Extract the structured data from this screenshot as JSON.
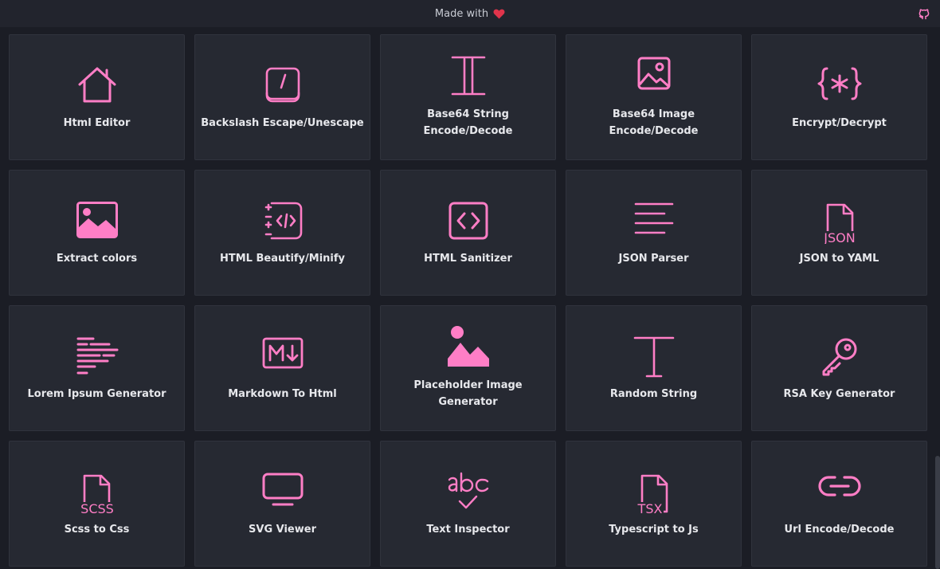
{
  "header": {
    "made_with": "Made with",
    "heart_icon": "heart-icon",
    "github_icon": "github-icon"
  },
  "colors": {
    "accent": "#ff7ec6",
    "card_bg": "#262932",
    "page_bg": "#1b1d25",
    "heart": "#e0344b"
  },
  "tools": [
    {
      "label": "Html Editor",
      "icon": "home-icon"
    },
    {
      "label": "Backslash Escape/Unescape",
      "icon": "backslash-key-icon"
    },
    {
      "label": "Base64 String Encode/Decode",
      "icon": "text-cursor-icon"
    },
    {
      "label": "Base64 Image Encode/Decode",
      "icon": "image-icon"
    },
    {
      "label": "Encrypt/Decrypt",
      "icon": "braces-asterisk-icon"
    },
    {
      "label": "Extract colors",
      "icon": "picture-icon"
    },
    {
      "label": "HTML Beautify/Minify",
      "icon": "code-format-icon"
    },
    {
      "label": "HTML Sanitizer",
      "icon": "code-box-icon"
    },
    {
      "label": "JSON Parser",
      "icon": "align-lines-icon"
    },
    {
      "label": "JSON to YAML",
      "icon": "json-file-icon"
    },
    {
      "label": "Lorem Ipsum Generator",
      "icon": "text-lines-icon"
    },
    {
      "label": "Markdown To Html",
      "icon": "markdown-icon"
    },
    {
      "label": "Placeholder Image Generator",
      "icon": "landscape-icon"
    },
    {
      "label": "Random String",
      "icon": "letter-t-icon"
    },
    {
      "label": "RSA Key Generator",
      "icon": "key-icon"
    },
    {
      "label": "Scss to Css",
      "icon": "scss-file-icon"
    },
    {
      "label": "SVG Viewer",
      "icon": "monitor-icon"
    },
    {
      "label": "Text Inspector",
      "icon": "abc-check-icon"
    },
    {
      "label": "Typescript to Js",
      "icon": "tsx-file-icon"
    },
    {
      "label": "Url Encode/Decode",
      "icon": "link-icon"
    }
  ]
}
